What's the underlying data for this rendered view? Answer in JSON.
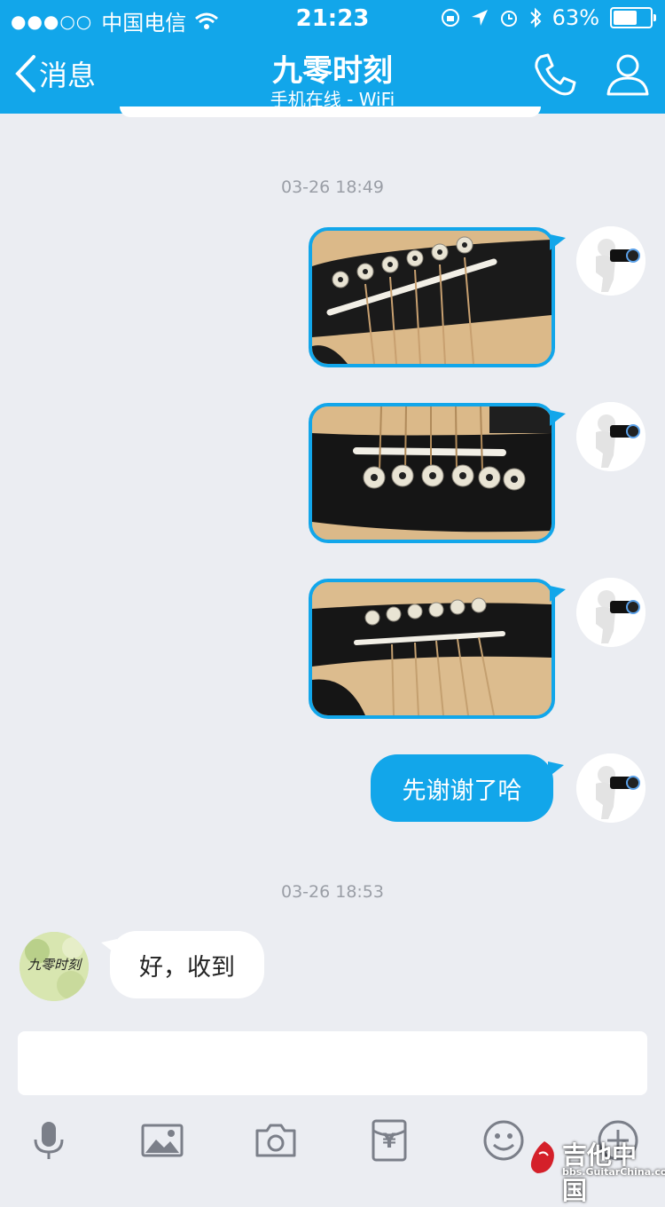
{
  "status_bar": {
    "signal": "●●●○○",
    "carrier": "中国电信",
    "time": "21:23",
    "battery": "63%"
  },
  "nav": {
    "back_label": "消息",
    "title": "九零时刻",
    "subtitle": "手机在线 - WiFi",
    "call_icon": "phone-icon",
    "profile_icon": "person-icon"
  },
  "chat": {
    "timestamp_1": "03-26 18:49",
    "timestamp_2": "03-26 18:53",
    "sent_text": "先谢谢了哈",
    "received_text": "好，收到",
    "contact_avatar_text": "九零时刻"
  },
  "toolbar": {
    "icons": [
      "microphone-icon",
      "image-icon",
      "camera-icon",
      "red-envelope-icon",
      "emoji-icon",
      "plus-icon"
    ],
    "red_envelope_symbol": "¥"
  },
  "watermark": {
    "name": "吉他中国",
    "url": "bbs.GuitarChina.com"
  },
  "colors": {
    "accent": "#12a6ea",
    "background": "#ebedf2"
  }
}
